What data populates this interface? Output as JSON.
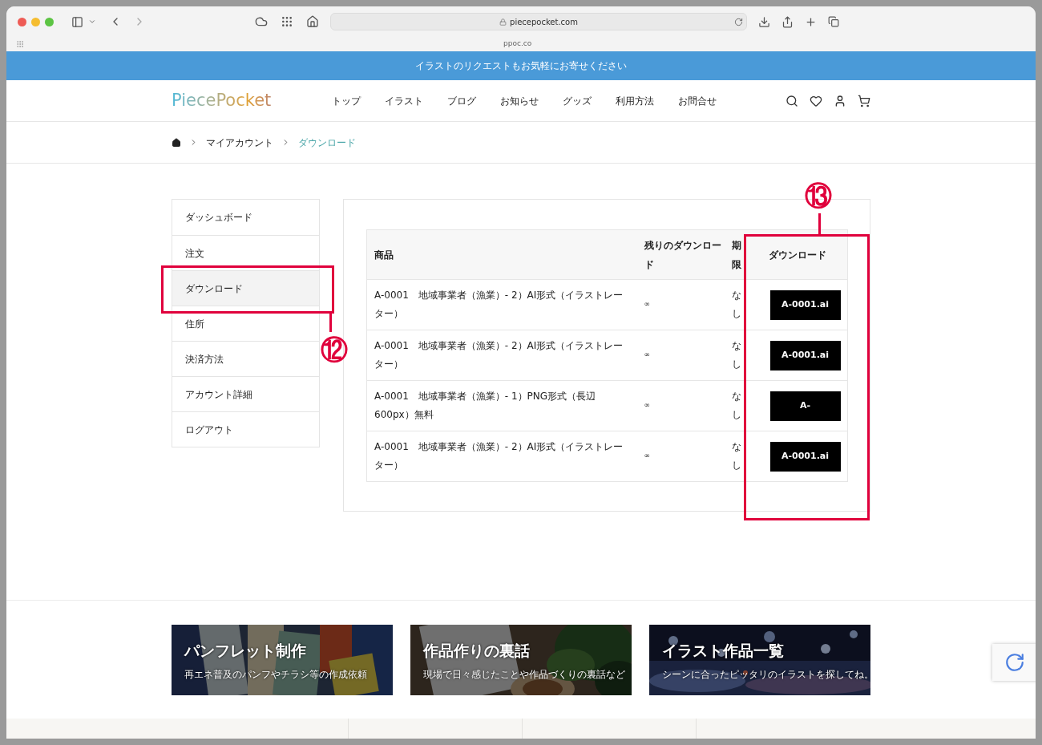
{
  "browser": {
    "address": "piecepocket.com",
    "tab_hint": "ppoc.co"
  },
  "banner": "イラストのリクエストもお気軽にお寄せください",
  "logo": "PiecePocket",
  "nav": [
    "トップ",
    "イラスト",
    "ブログ",
    "お知らせ",
    "グッズ",
    "利用方法",
    "お問合せ"
  ],
  "breadcrumb": [
    {
      "label": "マイアカウント",
      "selected": false
    },
    {
      "label": "ダウンロード",
      "selected": true
    }
  ],
  "sidebar": [
    {
      "label": "ダッシュボード",
      "selected": false
    },
    {
      "label": "注文",
      "selected": false
    },
    {
      "label": "ダウンロード",
      "selected": true
    },
    {
      "label": "住所",
      "selected": false
    },
    {
      "label": "決済方法",
      "selected": false
    },
    {
      "label": "アカウント詳細",
      "selected": false
    },
    {
      "label": "ログアウト",
      "selected": false
    }
  ],
  "table": {
    "columns": [
      "商品",
      "残りのダウンロード",
      "期限",
      "ダウンロード"
    ],
    "rows": [
      {
        "product": "A-0001　地域事業者（漁業）- 2）AI形式（イラストレーター）",
        "remaining": "∞",
        "expires": "なし",
        "download": "A-0001.ai"
      },
      {
        "product": "A-0001　地域事業者（漁業）- 2）AI形式（イラストレーター）",
        "remaining": "∞",
        "expires": "なし",
        "download": "A-0001.ai"
      },
      {
        "product": "A-0001　地域事業者（漁業）- 1）PNG形式（長辺600px）無料",
        "remaining": "∞",
        "expires": "なし",
        "download": "A-"
      },
      {
        "product": "A-0001　地域事業者（漁業）- 2）AI形式（イラストレーター）",
        "remaining": "∞",
        "expires": "なし",
        "download": "A-0001.ai"
      }
    ]
  },
  "annotations": [
    "⑫",
    "⑬"
  ],
  "promos": [
    {
      "title": "パンフレット制作",
      "subtitle": "再エネ普及のパンフやチラシ等の作成依頼"
    },
    {
      "title": "作品作りの裏話",
      "subtitle": "現場で日々感じたことや作品づくりの裏話など"
    },
    {
      "title": "イラスト作品一覧",
      "subtitle": "シーンに合ったピッタリのイラストを探してね。"
    }
  ]
}
